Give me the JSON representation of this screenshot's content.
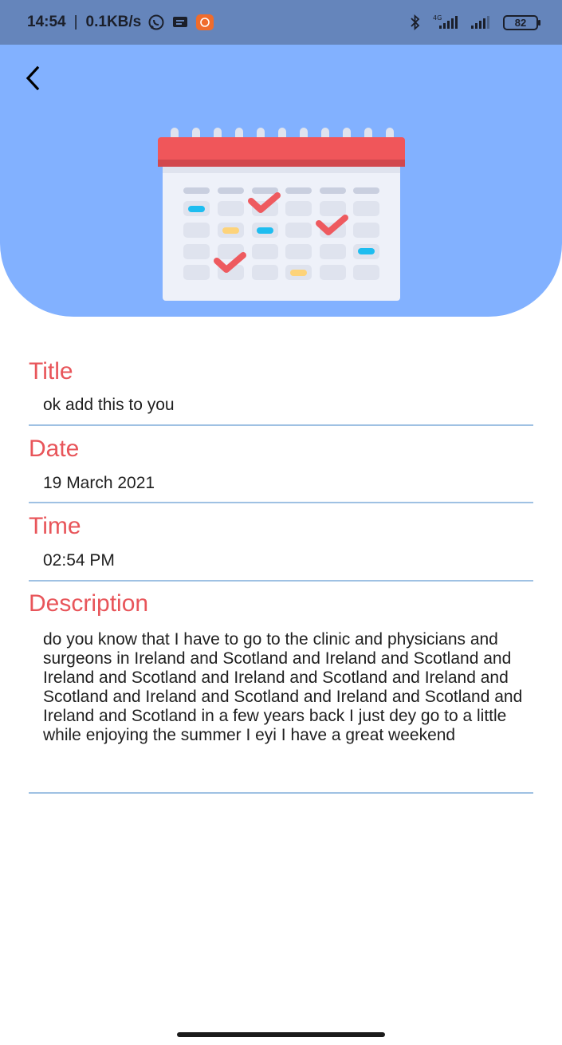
{
  "status_bar": {
    "time": "14:54",
    "network_speed": "0.1KB/s",
    "network_type": "4G",
    "battery_level": "82",
    "icons": [
      "whatsapp-icon",
      "message-icon",
      "mi-app-icon",
      "bluetooth-icon",
      "signal-4g-icon",
      "signal-icon",
      "battery-icon"
    ]
  },
  "header": {
    "back_icon": "chevron-left-icon",
    "illustration": "calendar-illustration",
    "background_color": "#82b1ff"
  },
  "fields": {
    "title": {
      "label": "Title",
      "value": "ok add this to you"
    },
    "date": {
      "label": "Date",
      "value": "19 March 2021"
    },
    "time": {
      "label": "Time",
      "value": "02:54 PM"
    },
    "description": {
      "label": "Description",
      "value": "do you know that I have to go to the clinic and physicians and surgeons in Ireland and Scotland and Ireland and Scotland and Ireland and Scotland and Ireland and Scotland and Ireland and Scotland and Ireland and Scotland and Ireland and Scotland and Ireland and Scotland in a few years back I just dey go to a little while enjoying the summer I eyi I have a great weekend"
    }
  },
  "colors": {
    "label": "#e8555a",
    "divider": "#9fc1e3",
    "status_bar": "#6585bb"
  }
}
